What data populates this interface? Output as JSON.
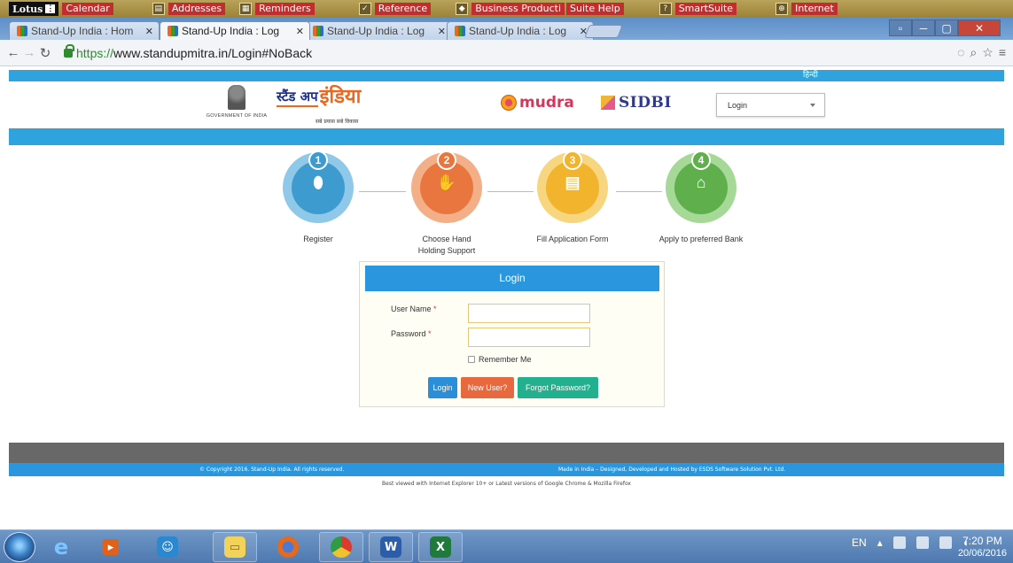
{
  "lotus_bar": {
    "logo": "Lotus",
    "items": [
      {
        "label": "Calendar",
        "icon": "calendar-icon"
      },
      {
        "label": "Addresses",
        "icon": "addresses-icon"
      },
      {
        "label": "Reminders",
        "icon": "reminders-icon"
      },
      {
        "label": "Reference",
        "icon": "reference-icon"
      },
      {
        "label": "Business Producti",
        "icon": "business-icon"
      },
      {
        "label": "Suite Help",
        "icon": "help-icon"
      },
      {
        "label": "SmartSuite",
        "icon": "smartsuite-icon"
      },
      {
        "label": "Internet",
        "icon": "internet-icon"
      }
    ]
  },
  "browser": {
    "tabs": [
      {
        "title": "Stand-Up India : Hom",
        "active": false
      },
      {
        "title": "Stand-Up India : Log",
        "active": true
      },
      {
        "title": "Stand-Up India : Log",
        "active": false
      },
      {
        "title": "Stand-Up India : Log",
        "active": false
      }
    ],
    "url_scheme": "https://",
    "url_rest": "www.standupmitra.in/Login#NoBack"
  },
  "site": {
    "language_link": "हिन्दी",
    "govt_text": "GOVERNMENT OF INDIA",
    "logo_hindi": "स्टैंड अप",
    "logo_india": "इंडिया",
    "logo_tagline": "सबे प्रयास सबे विकास",
    "mudra": "mudra",
    "sidbi": "SIDBI",
    "login_dropdown": "Login",
    "steps": [
      {
        "num": "1",
        "label": "Register",
        "color": "#3e9bd0",
        "ring": "#8fc8e8",
        "glyph": "mouse-icon"
      },
      {
        "num": "2",
        "label": "Choose Hand Holding Support",
        "color": "#e8763e",
        "ring": "#f3b088",
        "glyph": "handshake-icon"
      },
      {
        "num": "3",
        "label": "Fill Application Form",
        "color": "#f2b42c",
        "ring": "#f7d67f",
        "glyph": "form-icon"
      },
      {
        "num": "4",
        "label": "Apply to preferred Bank",
        "color": "#5fb04c",
        "ring": "#a6d897",
        "glyph": "bank-icon"
      }
    ],
    "login_form": {
      "title": "Login",
      "username_label": "User Name",
      "password_label": "Password",
      "required_mark": "*",
      "remember_label": "Remember Me",
      "login_button": "Login",
      "new_user_button": "New User?",
      "forgot_button": "Forgot Password?"
    },
    "footer": {
      "copyright": "© Copyright 2016. Stand-Up India. All rights reserved.",
      "made_in": "Made in India – Designed, Developed and Hosted by ESDS Software Solution Pvt. Ltd.",
      "note": "Best viewed with Internet Explorer 10+ or Latest versions of Google Chrome & Mozilla Firefox"
    }
  },
  "taskbar": {
    "apps": [
      "internet-explorer-icon",
      "media-icon",
      "people-icon",
      "folder-icon",
      "firefox-icon",
      "chrome-icon",
      "word-icon",
      "excel-icon"
    ],
    "lang": "EN",
    "time": "7:20 PM",
    "date": "20/06/2016"
  }
}
